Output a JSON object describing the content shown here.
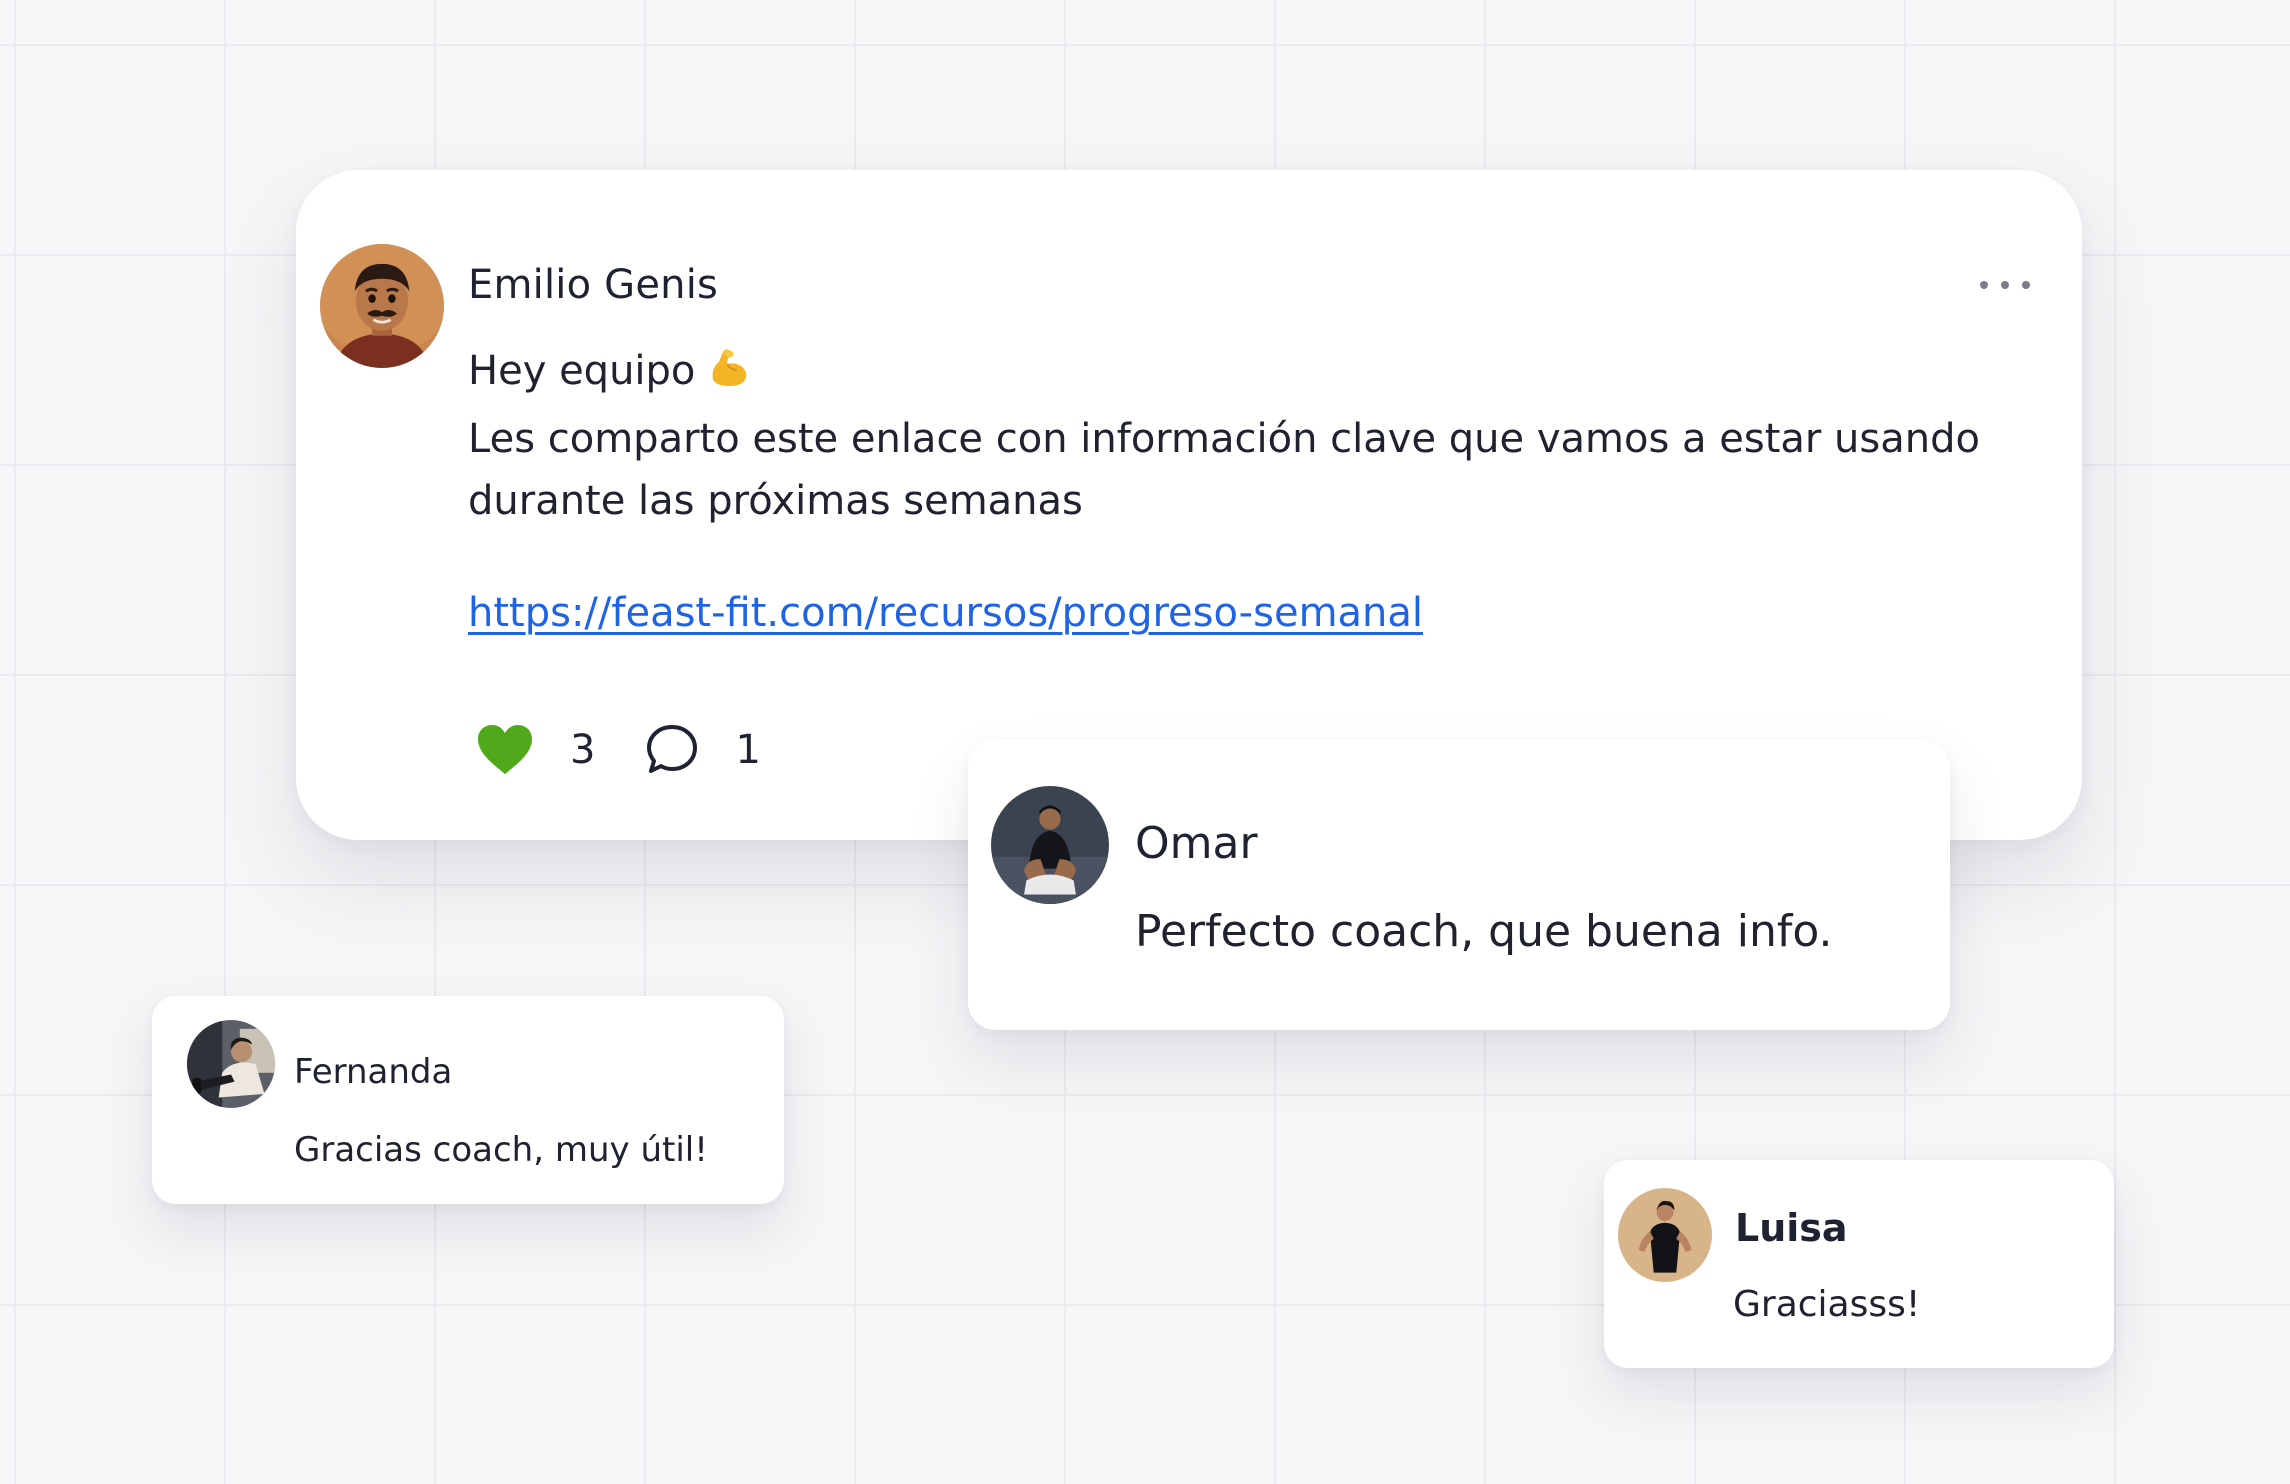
{
  "post": {
    "author": "Emilio Genis",
    "greeting": "Hey equipo",
    "greeting_emoji": "flexed-biceps",
    "message": "Les comparto este enlace con información clave que vamos a estar usando durante las próximas semanas",
    "link": "https://feast-fit.com/recursos/progreso-semanal",
    "likes": "3",
    "comments": "1",
    "more_icon": "ellipsis-icon",
    "like_icon": "heart-icon",
    "comment_icon": "speech-bubble-icon"
  },
  "comments": [
    {
      "name": "Omar",
      "text": "Perfecto coach, que buena info."
    },
    {
      "name": "Fernanda",
      "text": "Gracias coach, muy útil!"
    },
    {
      "name": "Luisa",
      "text": "Graciasss!"
    }
  ],
  "colors": {
    "background": "#f6f6f8",
    "card": "#ffffff",
    "link": "#1f63e6",
    "like": "#4fa91a",
    "text": "#1f2230"
  }
}
